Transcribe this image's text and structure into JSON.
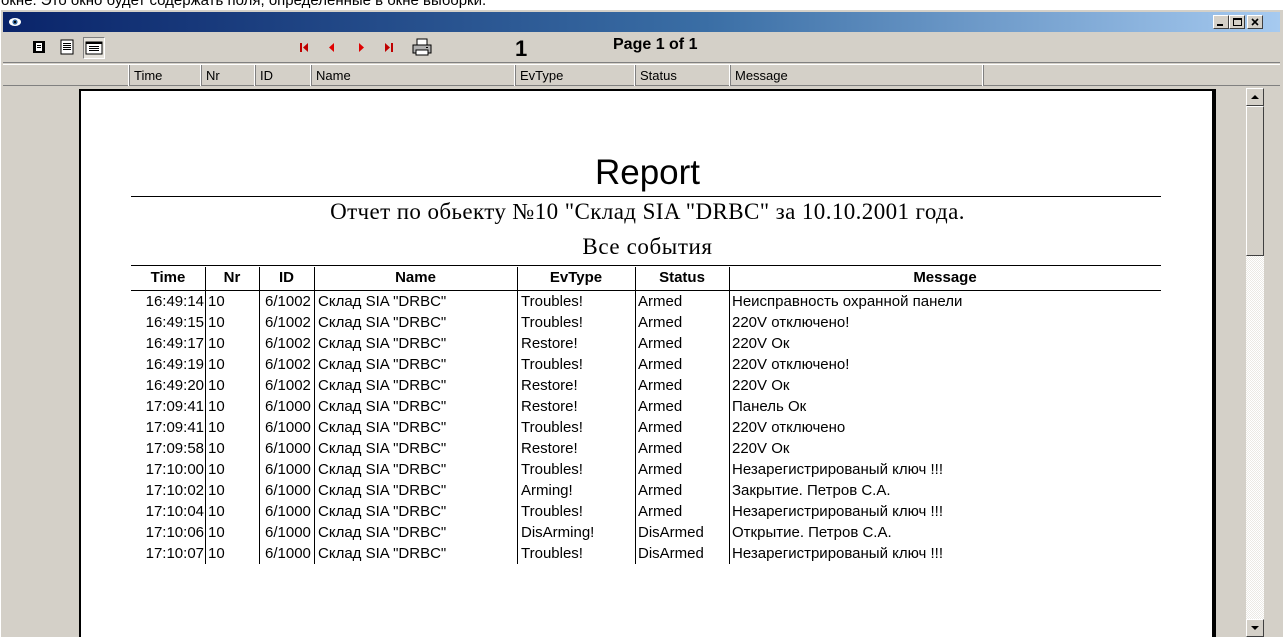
{
  "caption": "окне. Это окно будет содержать поля, определенные в окне выборки.",
  "toolbar": {
    "page_number": "1",
    "page_of": "Page 1 of 1"
  },
  "columns": [
    "Time",
    "Nr",
    "ID",
    "Name",
    "EvType",
    "Status",
    "Message"
  ],
  "report": {
    "title": "Report",
    "subtitle": "Отчет по обьекту №10 \"Склад SIA \"DRBC\" за 10.10.2001 года.",
    "subtitle2": "Все события",
    "headers": [
      "Time",
      "Nr",
      "ID",
      "Name",
      "EvType",
      "Status",
      "Message"
    ],
    "rows": [
      [
        "16:49:14",
        "10",
        "6/1002",
        "Склад SIA \"DRBC\"",
        "Troubles!",
        "Armed",
        "Неисправность охранной панели"
      ],
      [
        "16:49:15",
        "10",
        "6/1002",
        "Склад SIA \"DRBC\"",
        "Troubles!",
        "Armed",
        "220V отключено!"
      ],
      [
        "16:49:17",
        "10",
        "6/1002",
        "Склад SIA \"DRBC\"",
        "Restore!",
        "Armed",
        "220V Ок"
      ],
      [
        "16:49:19",
        "10",
        "6/1002",
        "Склад SIA \"DRBC\"",
        "Troubles!",
        "Armed",
        "220V отключено!"
      ],
      [
        "16:49:20",
        "10",
        "6/1002",
        "Склад SIA \"DRBC\"",
        "Restore!",
        "Armed",
        "220V Ок"
      ],
      [
        "17:09:41",
        "10",
        "6/1000",
        "Склад SIA \"DRBC\"",
        "Restore!",
        "Armed",
        "Панель Ок"
      ],
      [
        "17:09:41",
        "10",
        "6/1000",
        "Склад SIA \"DRBC\"",
        "Troubles!",
        "Armed",
        "220V отключено"
      ],
      [
        "17:09:58",
        "10",
        "6/1000",
        "Склад SIA \"DRBC\"",
        "Restore!",
        "Armed",
        "220V Ок"
      ],
      [
        "17:10:00",
        "10",
        "6/1000",
        "Склад SIA \"DRBC\"",
        "Troubles!",
        "Armed",
        "Незарегистрированый ключ !!!"
      ],
      [
        "17:10:02",
        "10",
        "6/1000",
        "Склад SIA \"DRBC\"",
        "Arming!",
        "Armed",
        "Закрытие. Петров С.А."
      ],
      [
        "17:10:04",
        "10",
        "6/1000",
        "Склад SIA \"DRBC\"",
        "Troubles!",
        "Armed",
        "Незарегистрированый ключ !!!"
      ],
      [
        "17:10:06",
        "10",
        "6/1000",
        "Склад SIA \"DRBC\"",
        "DisArming!",
        "DisArmed",
        "Открытие. Петров С.А."
      ],
      [
        "17:10:07",
        "10",
        "6/1000",
        "Склад SIA \"DRBC\"",
        "Troubles!",
        "DisArmed",
        "Незарегистрированый ключ !!!"
      ]
    ]
  },
  "icons": {
    "app": "eye-icon",
    "view": [
      "single-page-icon",
      "page-width-icon",
      "full-page-icon"
    ],
    "nav": [
      "first-page-icon",
      "prev-page-icon",
      "next-page-icon",
      "last-page-icon"
    ],
    "print": "printer-icon"
  },
  "colors": {
    "titlebar_start": "#0a246a",
    "titlebar_end": "#a6caf0",
    "nav_first_last": "#c00000",
    "nav_prev_next": "#e00000"
  }
}
